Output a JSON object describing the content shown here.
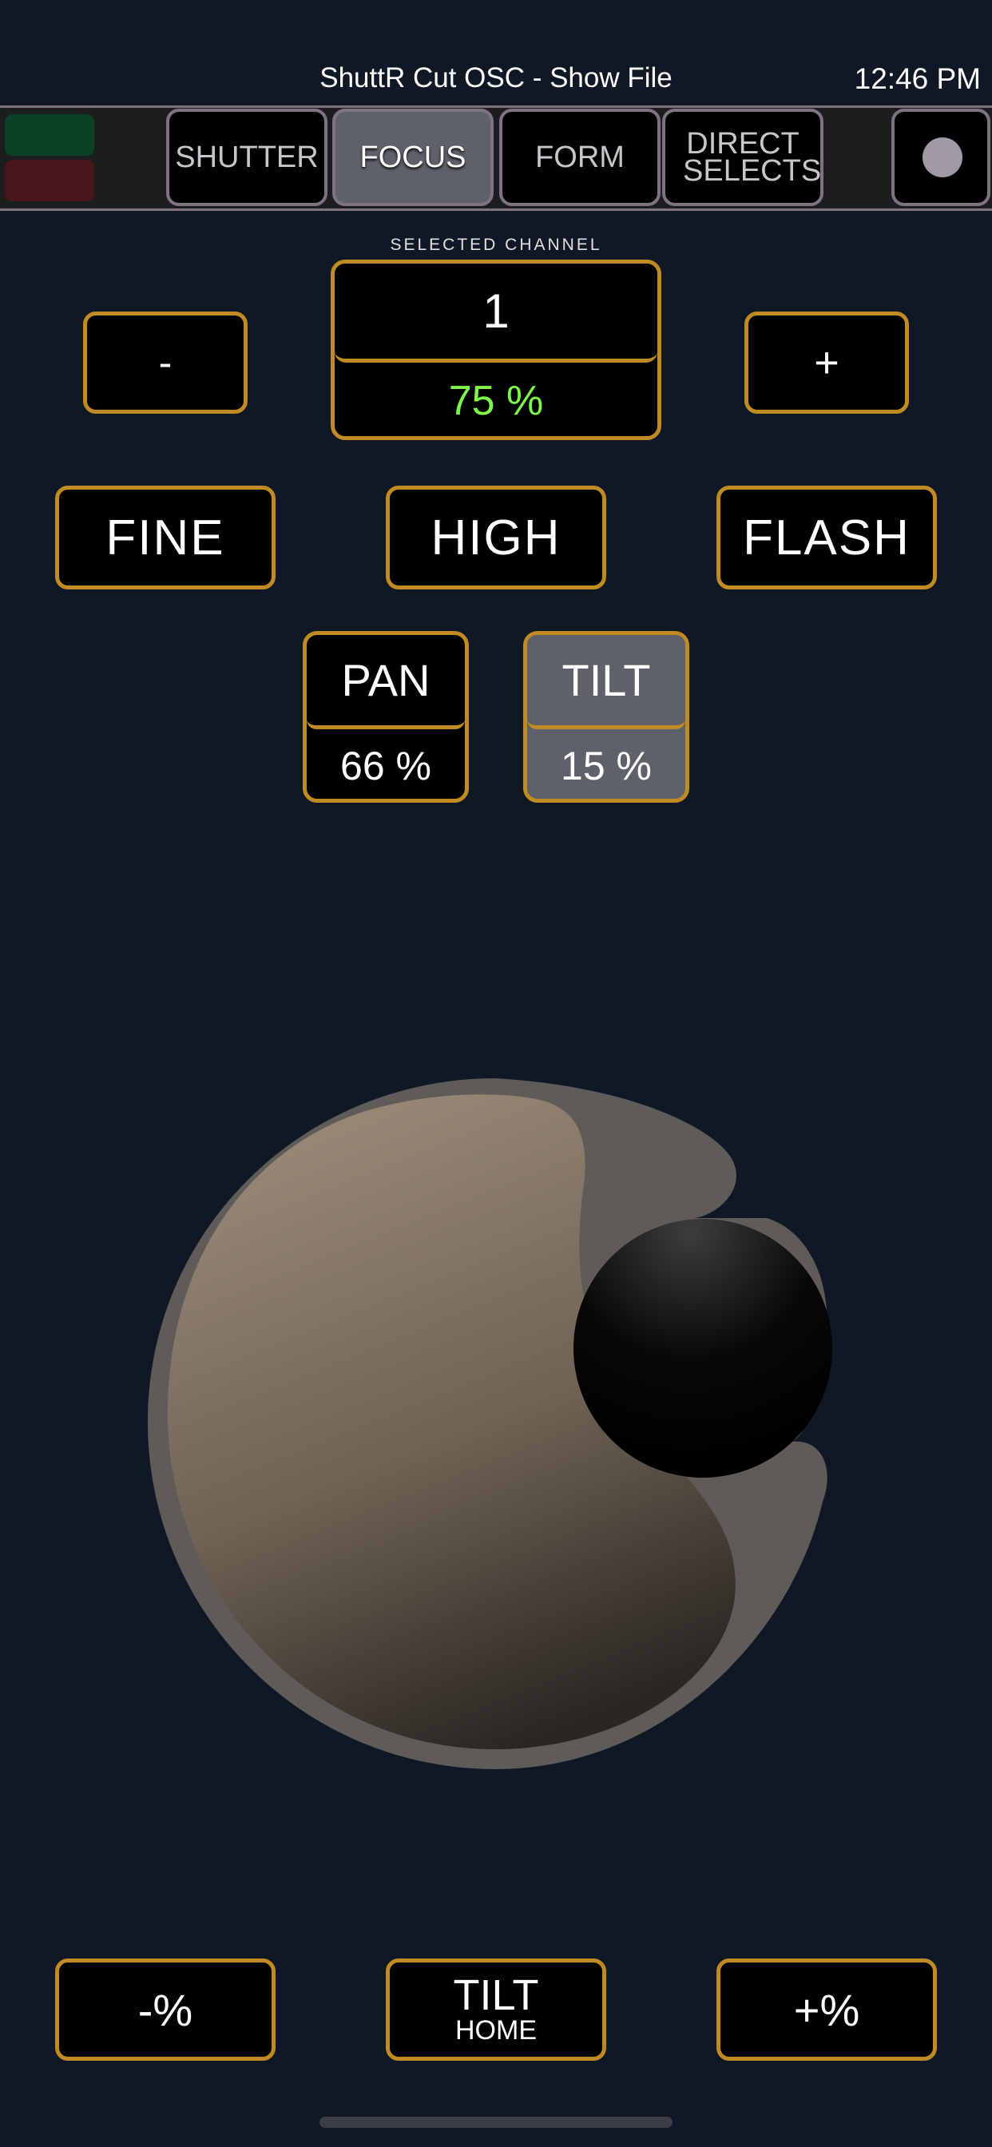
{
  "header": {
    "title": "ShuttR Cut OSC - Show File",
    "time": "12:46 PM"
  },
  "tabs": [
    {
      "label": "SHUTTER",
      "active": false
    },
    {
      "label": "FOCUS",
      "active": true
    },
    {
      "label": "FORM",
      "active": false
    },
    {
      "label": "DIRECT SELECTS",
      "active": false
    }
  ],
  "status": {
    "connected_color": "#0a4127",
    "disconnected_color": "#4a161c"
  },
  "channel": {
    "section_label": "SELECTED CHANNEL",
    "number": "1",
    "level": "75 %",
    "decrement_label": "-",
    "increment_label": "+"
  },
  "modes": {
    "fine": "FINE",
    "high": "HIGH",
    "flash": "FLASH"
  },
  "pan": {
    "label": "PAN",
    "value": "66 %",
    "selected": false
  },
  "tilt": {
    "label": "TILT",
    "value": "15 %",
    "selected": true
  },
  "bottom": {
    "decrease": "-%",
    "home_main": "TILT",
    "home_sub": "HOME",
    "increase": "+%"
  },
  "colors": {
    "accent": "#c08b22",
    "background": "#0f1824",
    "level_text": "#7df74a",
    "selected_bg": "#5f616a"
  },
  "icons": {
    "record": "record-dot-icon"
  }
}
